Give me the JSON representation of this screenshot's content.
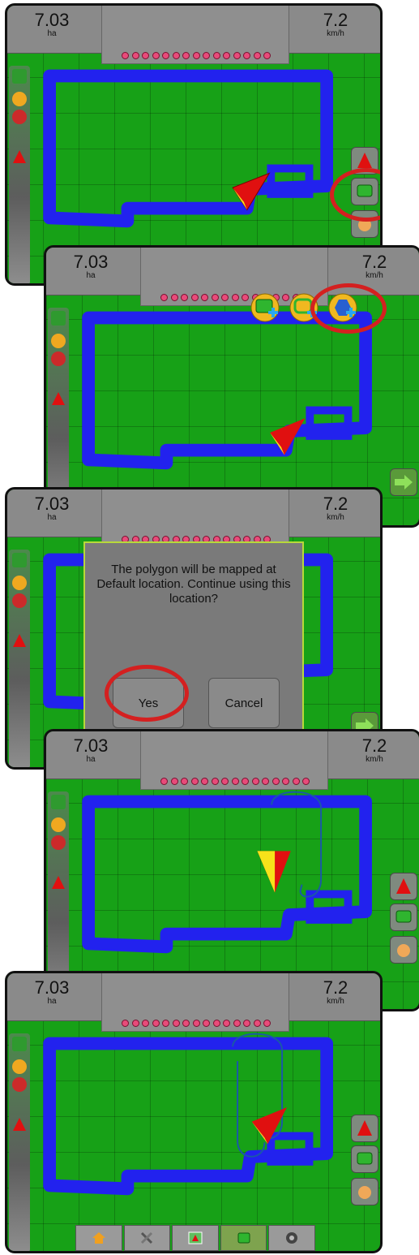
{
  "readouts": {
    "area_value": "7.03",
    "area_unit": "ha",
    "speed_value": "7.2",
    "speed_unit": "km/h"
  },
  "dialog": {
    "message": "The polygon will be mapped at Default location. Continue using this location?",
    "yes_label": "Yes",
    "cancel_label": "Cancel"
  },
  "icons": {
    "top_left": "guidance-mode-icon",
    "left_status": [
      "gps-status-icon",
      "boom-status-icon",
      "vehicle-icon"
    ],
    "right_buttons": [
      "nadir-view-icon",
      "marked-area-icon",
      "pan-hand-icon"
    ],
    "polygon_options": [
      "add-polygon-icon",
      "add-boundary-icon",
      "add-hexagon-icon"
    ],
    "next": "next-arrow-icon",
    "bottom_nav": [
      "home-icon",
      "tools-icon",
      "map-icon",
      "guidance-screen-icon",
      "camera-icon"
    ]
  },
  "colors": {
    "field": "#17a117",
    "coverage": "#2222ee",
    "highlight": "#d42020",
    "vehicle": "#e01010",
    "panel": "#8a8a8a"
  }
}
